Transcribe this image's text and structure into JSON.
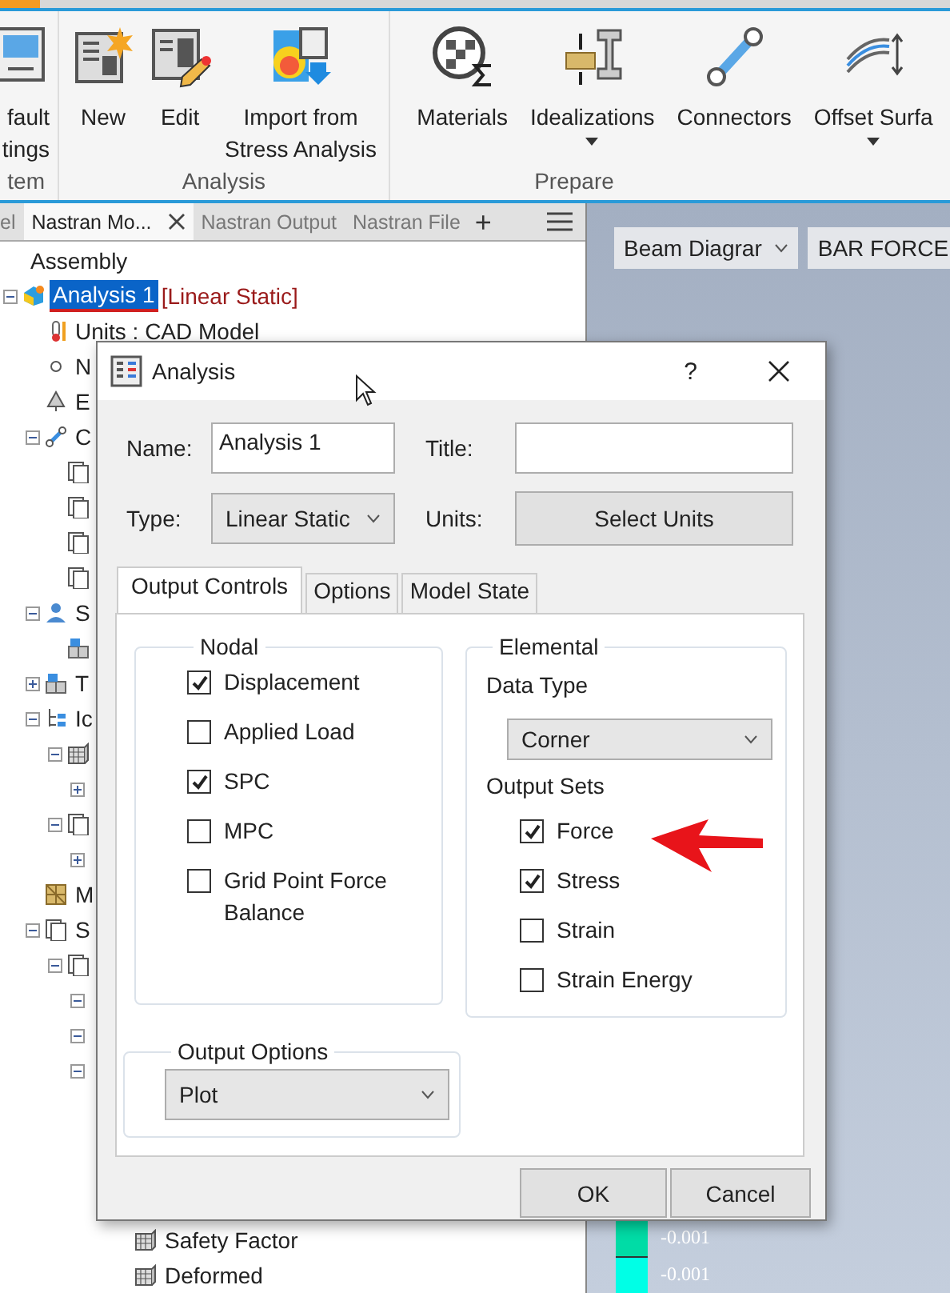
{
  "ribbon": {
    "groups": [
      {
        "label": "tem",
        "buttons": [
          {
            "lines": [
              "fault",
              "tings"
            ],
            "dropdown": false
          }
        ]
      },
      {
        "label": "Analysis",
        "buttons": [
          {
            "lines": [
              "New"
            ],
            "dropdown": false
          },
          {
            "lines": [
              "Edit"
            ],
            "dropdown": false
          },
          {
            "lines": [
              "Import from",
              "Stress Analysis"
            ],
            "dropdown": false
          }
        ]
      },
      {
        "label": "Prepare",
        "buttons": [
          {
            "lines": [
              "Materials"
            ],
            "dropdown": false
          },
          {
            "lines": [
              "Idealizations"
            ],
            "dropdown": true
          },
          {
            "lines": [
              "Connectors"
            ],
            "dropdown": false
          },
          {
            "lines": [
              "Offset Surfa"
            ],
            "dropdown": true
          }
        ]
      }
    ]
  },
  "panel_tabs": [
    {
      "label": "el",
      "selected": false,
      "closable": false
    },
    {
      "label": "Nastran Mo...",
      "selected": true,
      "closable": true
    },
    {
      "label": "Nastran Output",
      "selected": false,
      "closable": false
    },
    {
      "label": "Nastran File",
      "selected": false,
      "closable": false
    }
  ],
  "panel_add": "+",
  "tree": [
    {
      "label": "Assembly",
      "children": [
        {
          "label": "Analysis 1",
          "kind": "analysis",
          "tag": "[Linear Static]",
          "selected": true,
          "expanded": true,
          "children": [
            {
              "label": "Units : CAD Model",
              "kind": "units"
            },
            {
              "label": "N",
              "kind": "node"
            },
            {
              "label": "E",
              "kind": "element"
            },
            {
              "label": "C",
              "kind": "connector",
              "expanded": true,
              "children": [
                {
                  "kind": "document"
                },
                {
                  "kind": "document"
                },
                {
                  "kind": "document"
                },
                {
                  "kind": "document"
                }
              ]
            },
            {
              "label": "S",
              "kind": "support",
              "expanded": true,
              "children": [
                {
                  "kind": "block"
                }
              ]
            },
            {
              "label": "T",
              "kind": "block",
              "expanded": false
            },
            {
              "label": "Ic",
              "kind": "hierarchy",
              "expanded": true,
              "children": [
                {
                  "kind": "mesh",
                  "expanded": true,
                  "children": [
                    {
                      "expanded": false
                    }
                  ]
                },
                {
                  "kind": "document",
                  "expanded": true,
                  "children": [
                    {
                      "expanded": false
                    }
                  ]
                }
              ]
            },
            {
              "label": "M",
              "kind": "material"
            },
            {
              "label": "S",
              "kind": "document",
              "expanded": true,
              "children": [
                {
                  "kind": "document",
                  "expanded": true,
                  "children": [
                    {
                      "expanded": true
                    },
                    {
                      "expanded": true
                    },
                    {
                      "expanded": true,
                      "children": [
                        {
                          "children": [
                            {
                              "label": "Safety Factor",
                              "kind": "mesh"
                            },
                            {
                              "label": "Deformed",
                              "kind": "mesh"
                            }
                          ]
                        }
                      ]
                    }
                  ]
                }
              ]
            }
          ]
        }
      ]
    }
  ],
  "viewport": {
    "dropdowns": [
      {
        "value": "Beam Diagrar"
      },
      {
        "value": "BAR FORCE"
      }
    ],
    "legend": [
      {
        "color": "#00dca6",
        "label": "-0.001"
      },
      {
        "color": "#00ffe6",
        "label": "-0.001"
      }
    ]
  },
  "dialog": {
    "title": "Analysis",
    "help": "?",
    "name_label": "Name:",
    "name_value": "Analysis 1",
    "title_label": "Title:",
    "type_label": "Type:",
    "type_value": "Linear Static",
    "units_label": "Units:",
    "units_button": "Select Units",
    "tabs": [
      {
        "label": "Output Controls",
        "selected": true
      },
      {
        "label": "Options",
        "selected": false
      },
      {
        "label": "Model State",
        "selected": false
      }
    ],
    "nodal": {
      "title": "Nodal",
      "items": [
        {
          "label": "Displacement",
          "checked": true
        },
        {
          "label": "Applied Load",
          "checked": false
        },
        {
          "label": "SPC",
          "checked": true
        },
        {
          "label": "MPC",
          "checked": false
        },
        {
          "label": "Grid Point Force Balance",
          "checked": false
        }
      ]
    },
    "elemental": {
      "title": "Elemental",
      "data_type_label": "Data Type",
      "data_type_value": "Corner",
      "output_sets_label": "Output Sets",
      "items": [
        {
          "label": "Force",
          "checked": true
        },
        {
          "label": "Stress",
          "checked": true
        },
        {
          "label": "Strain",
          "checked": false
        },
        {
          "label": "Strain Energy",
          "checked": false
        }
      ]
    },
    "output_options": {
      "title": "Output Options",
      "value": "Plot"
    },
    "buttons": [
      "OK",
      "Cancel"
    ]
  }
}
